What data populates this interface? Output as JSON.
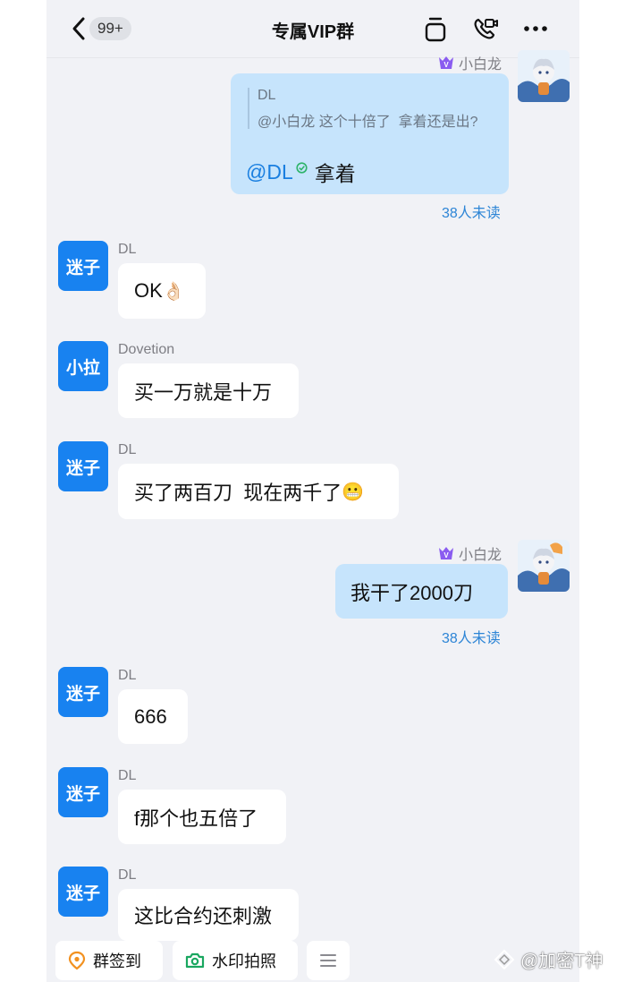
{
  "header": {
    "back_icon": "chevron-left-icon",
    "unread_count": "99+",
    "title": "专属VIP群",
    "icons": [
      "notes-icon",
      "video-call-icon",
      "more-icon"
    ]
  },
  "messages": [
    {
      "id": "m1",
      "side": "right",
      "sender": "小白龙",
      "quote_author": "DL",
      "quote_text": "@小白龙 这个十倍了  拿着还是出?",
      "mention": "@DL",
      "text": "拿着",
      "read_status": "38人未读"
    },
    {
      "id": "m2",
      "side": "left",
      "avatar_text": "迷子",
      "sender": "DL",
      "text": "OK",
      "emoji": "👌🏻"
    },
    {
      "id": "m3",
      "side": "left",
      "avatar_text": "小拉",
      "sender": "Dovetion",
      "text": "买一万就是十万"
    },
    {
      "id": "m4",
      "side": "left",
      "avatar_text": "迷子",
      "sender": "DL",
      "text": "买了两百刀  现在两千了",
      "emoji": "😬"
    },
    {
      "id": "m5",
      "side": "right",
      "sender": "小白龙",
      "text": "我干了2000刀",
      "read_status": "38人未读"
    },
    {
      "id": "m6",
      "side": "left",
      "avatar_text": "迷子",
      "sender": "DL",
      "text": "666"
    },
    {
      "id": "m7",
      "side": "left",
      "avatar_text": "迷子",
      "sender": "DL",
      "text": "f那个也五倍了"
    },
    {
      "id": "m8",
      "side": "left",
      "avatar_text": "迷子",
      "sender": "DL",
      "text": "这比合约还刺激"
    }
  ],
  "toolbar": {
    "checkin_label": "群签到",
    "photo_label": "水印拍照",
    "menu_icon": "menu-icon"
  },
  "watermark": "@加密T神",
  "colors": {
    "self_bubble": "#c6e4fc",
    "other_bubble": "#ffffff",
    "avatar_blue": "#1882f0",
    "read_status": "#2d85d6",
    "mention": "#1a7fe0",
    "chat_background": "#f1f2f6"
  }
}
